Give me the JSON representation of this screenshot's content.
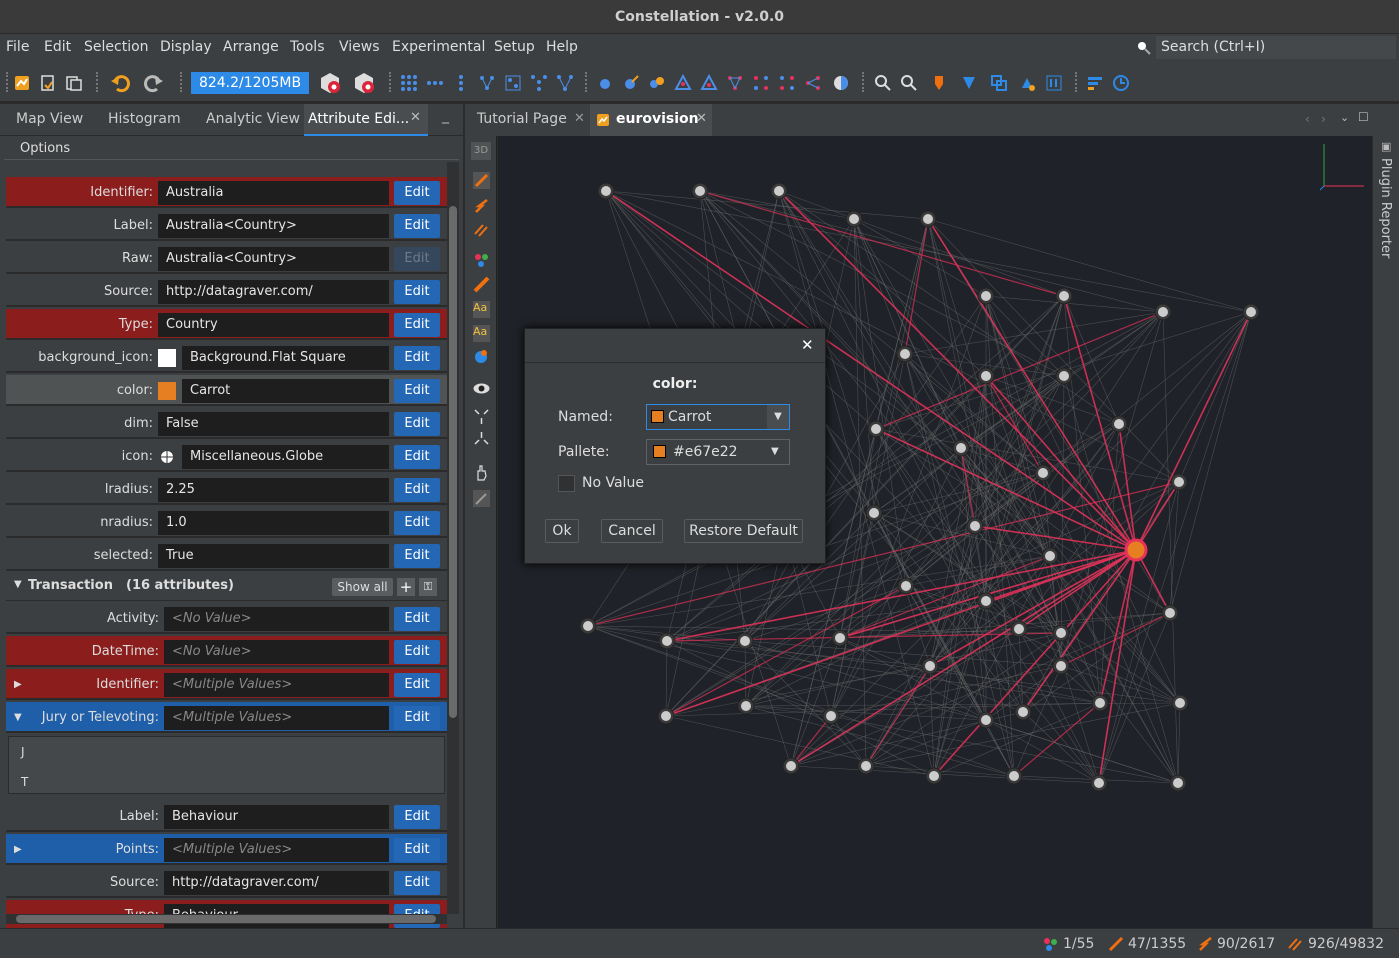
{
  "window": {
    "title": "Constellation - v2.0.0"
  },
  "menu": [
    "File",
    "Edit",
    "Selection",
    "Display",
    "Arrange",
    "Tools",
    "Views",
    "Experimental",
    "Setup",
    "Help"
  ],
  "search": {
    "placeholder": "Search (Ctrl+I)"
  },
  "toolbar": {
    "memory": "824.2/1205MB"
  },
  "left_tabs": {
    "map": "Map View",
    "histogram": "Histogram",
    "analytic": "Analytic View",
    "attribute": "Attribute Edi..."
  },
  "options_label": "Options",
  "node_attrs": [
    {
      "label": "Identifier:",
      "value": "Australia",
      "style": "red",
      "edit": "Edit"
    },
    {
      "label": "Label:",
      "value": "Australia<Country>",
      "style": "",
      "edit": "Edit"
    },
    {
      "label": "Raw:",
      "value": "Australia<Country>",
      "style": "",
      "edit": "Edit",
      "disabled": true
    },
    {
      "label": "Source:",
      "value": "http://datagraver.com/",
      "style": "",
      "edit": "Edit"
    },
    {
      "label": "Type:",
      "value": "Country",
      "style": "red",
      "edit": "Edit"
    },
    {
      "label": "background_icon:",
      "value": "Background.Flat Square",
      "style": "",
      "edit": "Edit",
      "swatch": "#ffffff"
    },
    {
      "label": "color:",
      "value": "Carrot",
      "style": "sel",
      "edit": "Edit",
      "swatch": "#e67e22"
    },
    {
      "label": "dim:",
      "value": "False",
      "style": "",
      "edit": "Edit"
    },
    {
      "label": "icon:",
      "value": "Miscellaneous.Globe",
      "style": "",
      "edit": "Edit",
      "globe": true
    },
    {
      "label": "lradius:",
      "value": "2.25",
      "style": "",
      "edit": "Edit"
    },
    {
      "label": "nradius:",
      "value": "1.0",
      "style": "",
      "edit": "Edit"
    },
    {
      "label": "selected:",
      "value": "True",
      "style": "",
      "edit": "Edit"
    }
  ],
  "transaction_group": {
    "title": "Transaction",
    "count": "(16 attributes)",
    "show_all": "Show all"
  },
  "tx_attrs": [
    {
      "label": "Activity:",
      "value": "<No Value>",
      "style": "",
      "edit": "Edit",
      "nv": true
    },
    {
      "label": "DateTime:",
      "value": "<No Value>",
      "style": "red",
      "edit": "Edit",
      "nv": true
    },
    {
      "label": "Identifier:",
      "value": "<Multiple Values>",
      "style": "red",
      "edit": "Edit",
      "nv": true,
      "tri": "▶"
    },
    {
      "label": "Jury or Televoting:",
      "value": "<Multiple Values>",
      "style": "blue",
      "edit": "Edit",
      "nv": true,
      "tri": "▼"
    }
  ],
  "jury_values": [
    "J",
    "T"
  ],
  "tx_attrs2": [
    {
      "label": "Label:",
      "value": "Behaviour",
      "style": "",
      "edit": "Edit"
    },
    {
      "label": "Points:",
      "value": "<Multiple Values>",
      "style": "blue",
      "edit": "Edit",
      "nv": true,
      "tri": "▶"
    },
    {
      "label": "Source:",
      "value": "http://datagraver.com/",
      "style": "",
      "edit": "Edit"
    },
    {
      "label": "Type:",
      "value": "Behaviour",
      "style": "red",
      "edit": "Edit"
    }
  ],
  "right_tabs": {
    "tutorial": "Tutorial Page",
    "eurovision": "eurovision"
  },
  "vtool": {
    "mode": "3D"
  },
  "side_panel": {
    "label": "Plugin Reporter"
  },
  "dialog": {
    "title": "color:",
    "named_label": "Named:",
    "named_value": "Carrot",
    "palette_label": "Pallete:",
    "palette_value": "#e67e22",
    "no_value": "No Value",
    "ok": "Ok",
    "cancel": "Cancel",
    "restore": "Restore Default",
    "swatch": "#e67e22"
  },
  "status": {
    "nodes": "1/55",
    "transactions": "47/1355",
    "edges": "90/2617",
    "links": "926/49832"
  },
  "colors": {
    "accent": "#2467b5",
    "highlight": "#8b1d1d",
    "edge": "#e8315a",
    "carrot": "#e67e22"
  }
}
